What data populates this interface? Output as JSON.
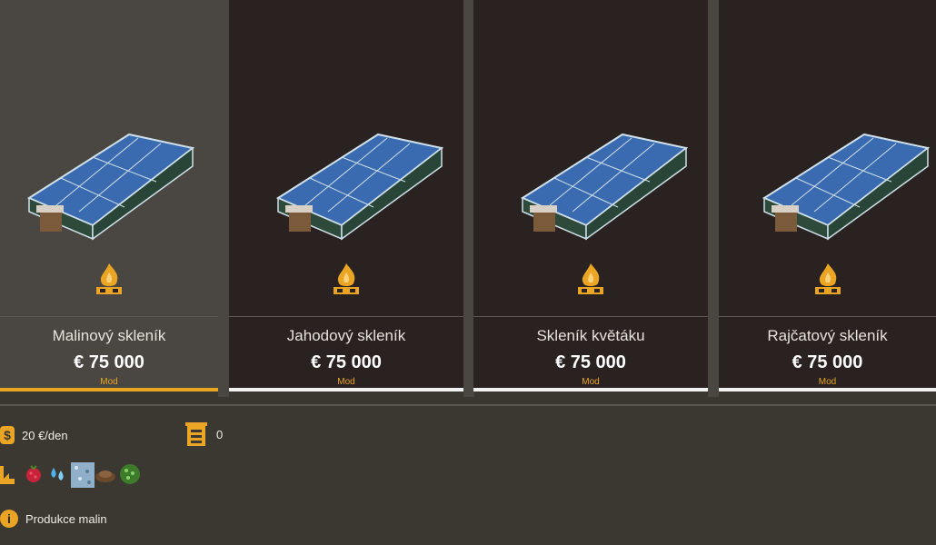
{
  "products": [
    {
      "name": "Malinový skleník",
      "price": "€ 75 000",
      "tag": "Mod",
      "selected": true
    },
    {
      "name": "Jahodový skleník",
      "price": "€ 75 000",
      "tag": "Mod",
      "selected": false
    },
    {
      "name": "Skleník květáku",
      "price": "€ 75 000",
      "tag": "Mod",
      "selected": false
    },
    {
      "name": "Rajčatový skleník",
      "price": "€ 75 000",
      "tag": "Mod",
      "selected": false
    }
  ],
  "details": {
    "upkeep": "20 €/den",
    "storage_count": "0",
    "description": "Produkce malin",
    "input_icons": [
      "factory-icon",
      "raspberry-icon",
      "water-drops-icon",
      "gravel-icon",
      "soil-icon",
      "fertilizer-icon"
    ]
  },
  "colors": {
    "accent": "#e9a523",
    "card_bg": "#2a2220",
    "selected_bg": "#4a4641"
  }
}
